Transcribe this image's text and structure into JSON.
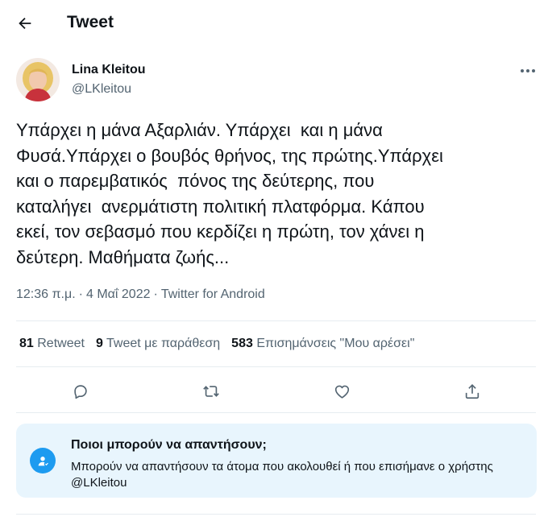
{
  "header": {
    "back_icon": "arrow-left-icon",
    "title": "Tweet"
  },
  "author": {
    "name": "Lina Kleitou",
    "handle": "@LKleitou",
    "more_icon": "more-horizontal-icon"
  },
  "tweet": {
    "text": "Υπάρχει η μάνα Αξαρλιάν. Υπάρχει  και η μάνα\nΦυσά.Υπάρχει ο βουβός θρήνος, της πρώτης.Υπάρχει\nκαι ο παρεμβατικός  πόνος της δεύτερης, που\nκαταλήγει  ανερμάτιστη πολιτική πλατφόρμα. Κάπου\nεκεί, τον σεβασμό που κερδίζει η πρώτη, τον χάνει η\nδεύτερη. Μαθήματα ζωής...",
    "time": "12:36 π.μ.",
    "separator1": "·",
    "date": "4 Μαΐ 2022",
    "separator2": "·",
    "source": "Twitter for Android"
  },
  "stats": {
    "retweets_count": "81",
    "retweets_label": "Retweet",
    "quotes_count": "9",
    "quotes_label": "Tweet με παράθεση",
    "likes_count": "583",
    "likes_label": "Επισημάνσεις \"Μου αρέσει\""
  },
  "actions": {
    "reply_icon": "reply-icon",
    "retweet_icon": "retweet-icon",
    "like_icon": "heart-icon",
    "share_icon": "share-icon"
  },
  "reply_restriction": {
    "icon": "at-sign-icon",
    "title": "Ποιοι μπορούν να απαντήσουν;",
    "description": "Μπορούν να απαντήσουν τα άτομα που ακολουθεί ή που επισήμανε ο χρήστης @LKleitou"
  },
  "colors": {
    "text_primary": "#0f1419",
    "text_secondary": "#536471",
    "accent": "#1d9bf0",
    "info_background": "#e8f5fd",
    "divider": "#e6ecf0"
  }
}
